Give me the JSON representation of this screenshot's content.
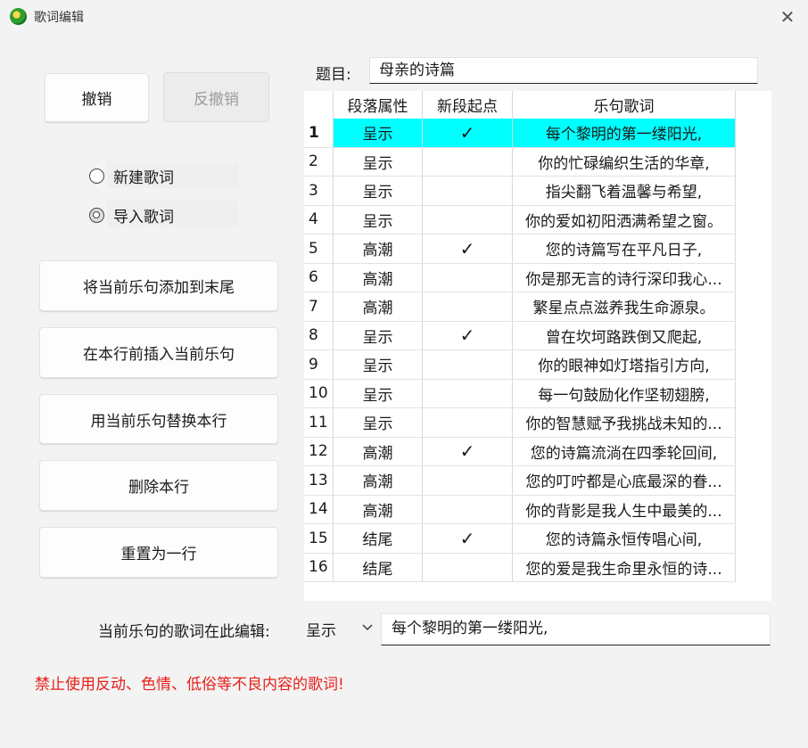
{
  "window": {
    "title": "歌词编辑",
    "close_glyph": "✕"
  },
  "buttons": {
    "undo": "撤销",
    "redo": "反撤销",
    "append": "将当前乐句添加到末尾",
    "insert": "在本行前插入当前乐句",
    "replace": "用当前乐句替换本行",
    "delete": "删除本行",
    "reset": "重置为一行"
  },
  "radios": {
    "new_lyrics": "新建歌词",
    "import_lyrics": "导入歌词",
    "selected": "import_lyrics"
  },
  "title_field": {
    "label": "题目:",
    "value": "母亲的诗篇"
  },
  "table": {
    "headers": [
      "",
      "段落属性",
      "新段起点",
      "乐句歌词"
    ],
    "selected_row": 1,
    "rows": [
      {
        "n": "1",
        "section": "呈示",
        "start": "✓",
        "lyric": "每个黎明的第一缕阳光,"
      },
      {
        "n": "2",
        "section": "呈示",
        "start": "",
        "lyric": "你的忙碌编织生活的华章,"
      },
      {
        "n": "3",
        "section": "呈示",
        "start": "",
        "lyric": "指尖翻飞着温馨与希望,"
      },
      {
        "n": "4",
        "section": "呈示",
        "start": "",
        "lyric": "你的爱如初阳洒满希望之窗。"
      },
      {
        "n": "5",
        "section": "高潮",
        "start": "✓",
        "lyric": "您的诗篇写在平凡日子,"
      },
      {
        "n": "6",
        "section": "高潮",
        "start": "",
        "lyric": "你是那无言的诗行深印我心..."
      },
      {
        "n": "7",
        "section": "高潮",
        "start": "",
        "lyric": "繁星点点滋养我生命源泉。"
      },
      {
        "n": "8",
        "section": "呈示",
        "start": "✓",
        "lyric": "曾在坎坷路跌倒又爬起,"
      },
      {
        "n": "9",
        "section": "呈示",
        "start": "",
        "lyric": "你的眼神如灯塔指引方向,"
      },
      {
        "n": "10",
        "section": "呈示",
        "start": "",
        "lyric": "每一句鼓励化作坚韧翅膀,"
      },
      {
        "n": "11",
        "section": "呈示",
        "start": "",
        "lyric": "你的智慧赋予我挑战未知的..."
      },
      {
        "n": "12",
        "section": "高潮",
        "start": "✓",
        "lyric": "您的诗篇流淌在四季轮回间,"
      },
      {
        "n": "13",
        "section": "高潮",
        "start": "",
        "lyric": "您的叮咛都是心底最深的眷..."
      },
      {
        "n": "14",
        "section": "高潮",
        "start": "",
        "lyric": "你的背影是我人生中最美的..."
      },
      {
        "n": "15",
        "section": "结尾",
        "start": "✓",
        "lyric": "您的诗篇永恒传唱心间,"
      },
      {
        "n": "16",
        "section": "结尾",
        "start": "",
        "lyric": "您的爱是我生命里永恒的诗..."
      }
    ]
  },
  "editor": {
    "label": "当前乐句的歌词在此编辑:",
    "section_value": "呈示",
    "lyric_value": "每个黎明的第一缕阳光,"
  },
  "warning": "禁止使用反动、色情、低俗等不良内容的歌词!",
  "colors": {
    "selection": "#00ffff",
    "warning": "#e8201a"
  }
}
